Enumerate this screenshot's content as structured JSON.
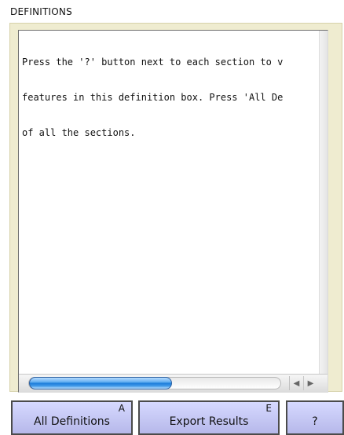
{
  "section_title": "DEFINITIONS",
  "definition_box": {
    "lines": [
      "Press the '?' button next to each section to v",
      "features in this definition box. Press 'All De",
      "of all the sections."
    ],
    "horizontal_scroll_position": 0.0
  },
  "scrollbar": {
    "left_arrow": "◀",
    "right_arrow": "▶"
  },
  "buttons": {
    "all_definitions": {
      "label": "All Definitions",
      "hotkey": "A"
    },
    "export_results": {
      "label": "Export Results",
      "hotkey": "E"
    },
    "help": {
      "label": "?"
    }
  },
  "colors": {
    "panel_background": "#efecd0",
    "button_fill": "#c5c8fa",
    "scroll_thumb": "#2a84d8"
  }
}
